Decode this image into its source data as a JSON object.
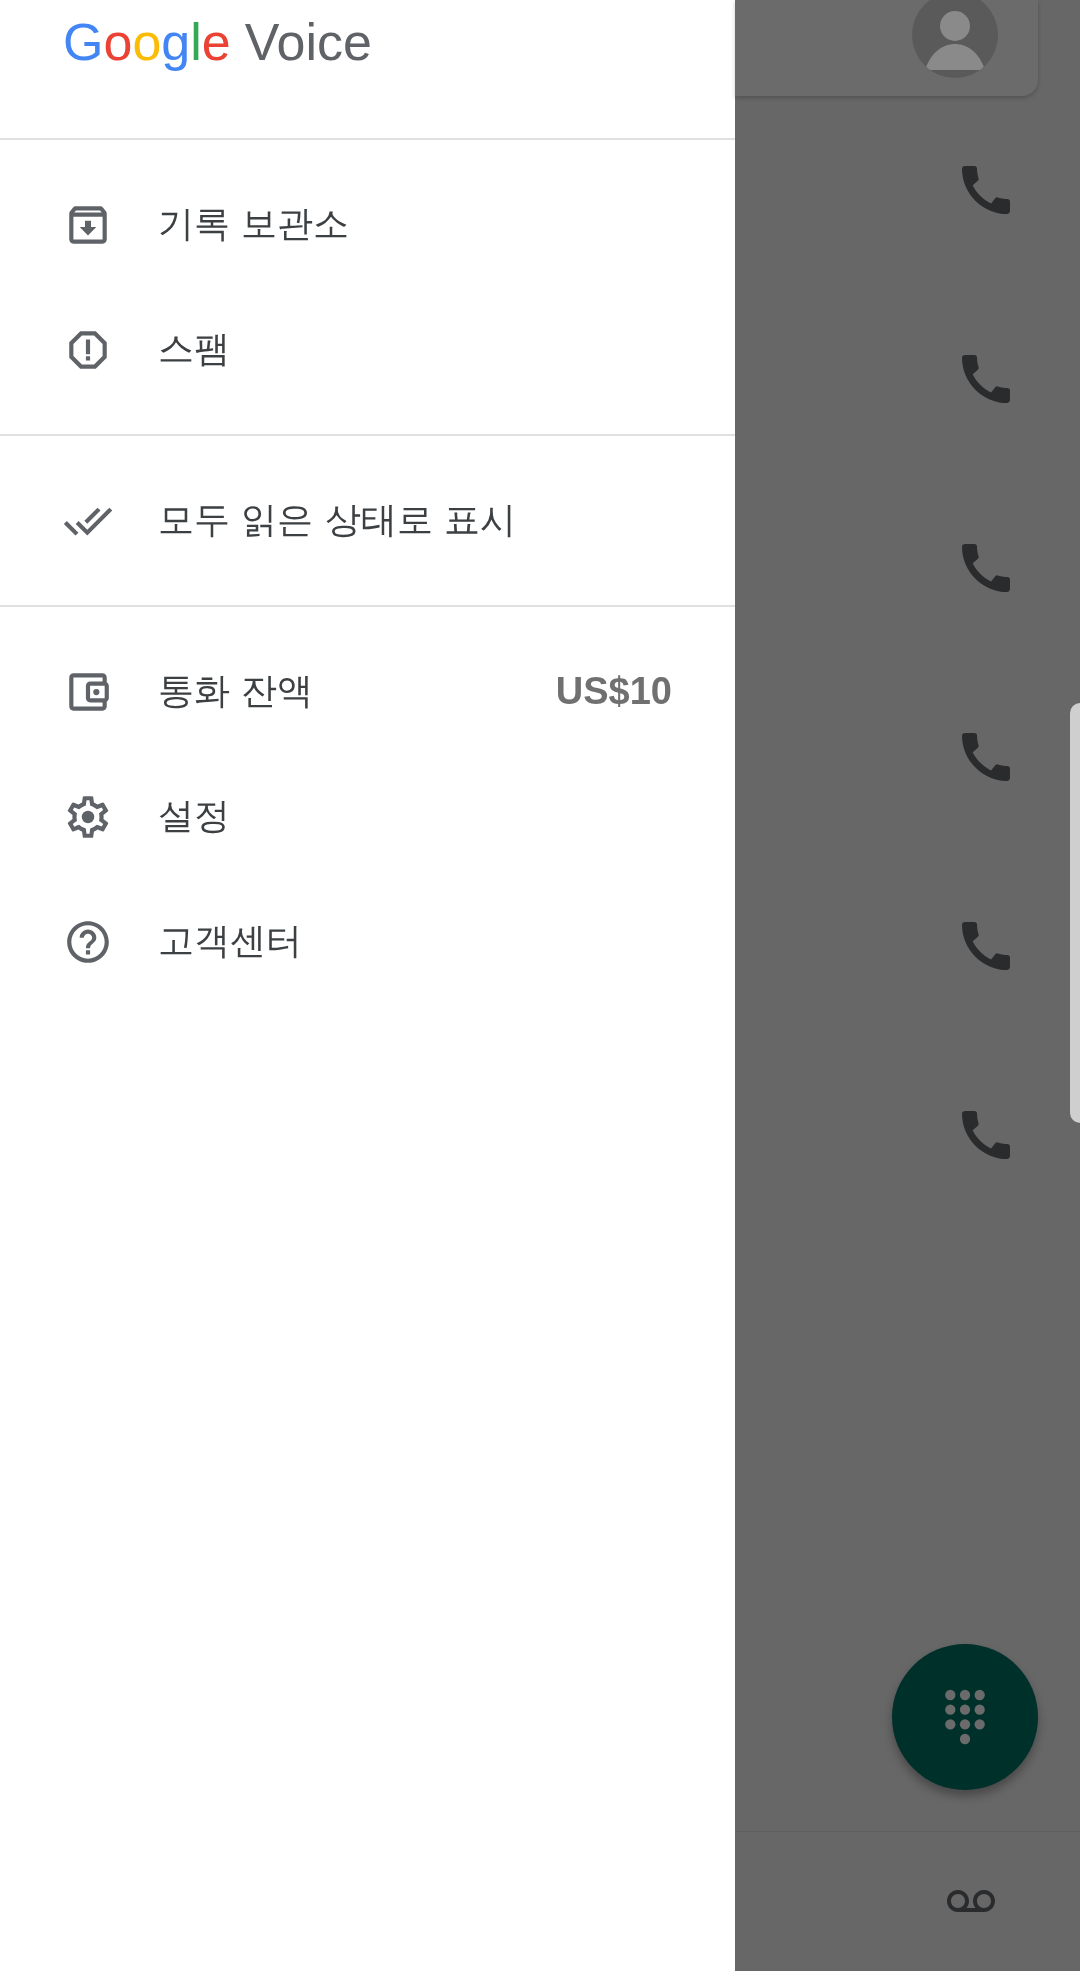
{
  "drawer": {
    "logo": {
      "brand": "Google",
      "product": "Voice"
    },
    "sections": [
      {
        "items": [
          {
            "label": "기록 보관소"
          },
          {
            "label": "스팸"
          }
        ]
      },
      {
        "items": [
          {
            "label": "모두 읽은 상태로 표시"
          }
        ]
      },
      {
        "items": [
          {
            "label": "통화 잔액",
            "value": "US$10"
          },
          {
            "label": "설정"
          },
          {
            "label": "고객센터"
          }
        ]
      }
    ]
  }
}
